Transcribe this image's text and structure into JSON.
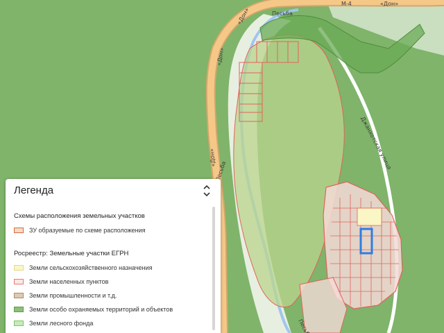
{
  "map": {
    "road_labels": {
      "don_1": "«Дон»",
      "don_2": "«Дон»",
      "don_3": "«Дон»",
      "don_4": "«Дон»",
      "m4": "М-4",
      "street": "Джанхотская улица",
      "river_top": "Песьба",
      "river_left": "Песьба",
      "river_bottom": "Песьба"
    },
    "colors": {
      "forest": "#7fb46a",
      "settlement_fill": "#f4d9d7",
      "settlement_border": "#e0635c",
      "protected_fill": "#6aab55",
      "selected_parcel": "#2f7de0",
      "road": "#f1b46e",
      "river": "#9fc6ef"
    }
  },
  "legend": {
    "title": "Легенда",
    "toggle_icon": "chevron-updown-icon",
    "sections": [
      {
        "title": "Схемы расположения земельных участков",
        "items": [
          {
            "label": "ЗУ образуемые по схеме расположения",
            "fill": "#f6dcc8",
            "border": "#d46a3b"
          }
        ]
      },
      {
        "title": "Росреестр: Земельные участки ЕГРН",
        "items": [
          {
            "label": "Земли сельскохозяйственного назначения",
            "fill": "#fbf6c6",
            "border": "#e2d98a"
          },
          {
            "label": "Земли населенных пунктов",
            "fill": "#fde7e4",
            "border": "#e57b70"
          },
          {
            "label": "Земли промышленности и т.д.",
            "fill": "#dccab1",
            "border": "#a98d6a"
          },
          {
            "label": "Земли особо охраняемых территорий и объектов",
            "fill": "#8fbf7b",
            "border": "#5f9b48"
          },
          {
            "label": "Земли лесного фонда",
            "fill": "#c6ecb8",
            "border": "#7dc56a"
          }
        ]
      }
    ]
  }
}
